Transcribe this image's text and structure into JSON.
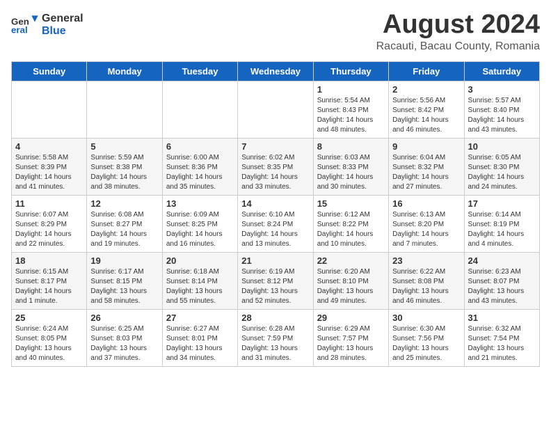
{
  "header": {
    "logo_general": "General",
    "logo_blue": "Blue",
    "month_year": "August 2024",
    "location": "Racauti, Bacau County, Romania"
  },
  "weekdays": [
    "Sunday",
    "Monday",
    "Tuesday",
    "Wednesday",
    "Thursday",
    "Friday",
    "Saturday"
  ],
  "weeks": [
    [
      {
        "day": "",
        "info": ""
      },
      {
        "day": "",
        "info": ""
      },
      {
        "day": "",
        "info": ""
      },
      {
        "day": "",
        "info": ""
      },
      {
        "day": "1",
        "info": "Sunrise: 5:54 AM\nSunset: 8:43 PM\nDaylight: 14 hours\nand 48 minutes."
      },
      {
        "day": "2",
        "info": "Sunrise: 5:56 AM\nSunset: 8:42 PM\nDaylight: 14 hours\nand 46 minutes."
      },
      {
        "day": "3",
        "info": "Sunrise: 5:57 AM\nSunset: 8:40 PM\nDaylight: 14 hours\nand 43 minutes."
      }
    ],
    [
      {
        "day": "4",
        "info": "Sunrise: 5:58 AM\nSunset: 8:39 PM\nDaylight: 14 hours\nand 41 minutes."
      },
      {
        "day": "5",
        "info": "Sunrise: 5:59 AM\nSunset: 8:38 PM\nDaylight: 14 hours\nand 38 minutes."
      },
      {
        "day": "6",
        "info": "Sunrise: 6:00 AM\nSunset: 8:36 PM\nDaylight: 14 hours\nand 35 minutes."
      },
      {
        "day": "7",
        "info": "Sunrise: 6:02 AM\nSunset: 8:35 PM\nDaylight: 14 hours\nand 33 minutes."
      },
      {
        "day": "8",
        "info": "Sunrise: 6:03 AM\nSunset: 8:33 PM\nDaylight: 14 hours\nand 30 minutes."
      },
      {
        "day": "9",
        "info": "Sunrise: 6:04 AM\nSunset: 8:32 PM\nDaylight: 14 hours\nand 27 minutes."
      },
      {
        "day": "10",
        "info": "Sunrise: 6:05 AM\nSunset: 8:30 PM\nDaylight: 14 hours\nand 24 minutes."
      }
    ],
    [
      {
        "day": "11",
        "info": "Sunrise: 6:07 AM\nSunset: 8:29 PM\nDaylight: 14 hours\nand 22 minutes."
      },
      {
        "day": "12",
        "info": "Sunrise: 6:08 AM\nSunset: 8:27 PM\nDaylight: 14 hours\nand 19 minutes."
      },
      {
        "day": "13",
        "info": "Sunrise: 6:09 AM\nSunset: 8:25 PM\nDaylight: 14 hours\nand 16 minutes."
      },
      {
        "day": "14",
        "info": "Sunrise: 6:10 AM\nSunset: 8:24 PM\nDaylight: 14 hours\nand 13 minutes."
      },
      {
        "day": "15",
        "info": "Sunrise: 6:12 AM\nSunset: 8:22 PM\nDaylight: 14 hours\nand 10 minutes."
      },
      {
        "day": "16",
        "info": "Sunrise: 6:13 AM\nSunset: 8:20 PM\nDaylight: 14 hours\nand 7 minutes."
      },
      {
        "day": "17",
        "info": "Sunrise: 6:14 AM\nSunset: 8:19 PM\nDaylight: 14 hours\nand 4 minutes."
      }
    ],
    [
      {
        "day": "18",
        "info": "Sunrise: 6:15 AM\nSunset: 8:17 PM\nDaylight: 14 hours\nand 1 minute."
      },
      {
        "day": "19",
        "info": "Sunrise: 6:17 AM\nSunset: 8:15 PM\nDaylight: 13 hours\nand 58 minutes."
      },
      {
        "day": "20",
        "info": "Sunrise: 6:18 AM\nSunset: 8:14 PM\nDaylight: 13 hours\nand 55 minutes."
      },
      {
        "day": "21",
        "info": "Sunrise: 6:19 AM\nSunset: 8:12 PM\nDaylight: 13 hours\nand 52 minutes."
      },
      {
        "day": "22",
        "info": "Sunrise: 6:20 AM\nSunset: 8:10 PM\nDaylight: 13 hours\nand 49 minutes."
      },
      {
        "day": "23",
        "info": "Sunrise: 6:22 AM\nSunset: 8:08 PM\nDaylight: 13 hours\nand 46 minutes."
      },
      {
        "day": "24",
        "info": "Sunrise: 6:23 AM\nSunset: 8:07 PM\nDaylight: 13 hours\nand 43 minutes."
      }
    ],
    [
      {
        "day": "25",
        "info": "Sunrise: 6:24 AM\nSunset: 8:05 PM\nDaylight: 13 hours\nand 40 minutes."
      },
      {
        "day": "26",
        "info": "Sunrise: 6:25 AM\nSunset: 8:03 PM\nDaylight: 13 hours\nand 37 minutes."
      },
      {
        "day": "27",
        "info": "Sunrise: 6:27 AM\nSunset: 8:01 PM\nDaylight: 13 hours\nand 34 minutes."
      },
      {
        "day": "28",
        "info": "Sunrise: 6:28 AM\nSunset: 7:59 PM\nDaylight: 13 hours\nand 31 minutes."
      },
      {
        "day": "29",
        "info": "Sunrise: 6:29 AM\nSunset: 7:57 PM\nDaylight: 13 hours\nand 28 minutes."
      },
      {
        "day": "30",
        "info": "Sunrise: 6:30 AM\nSunset: 7:56 PM\nDaylight: 13 hours\nand 25 minutes."
      },
      {
        "day": "31",
        "info": "Sunrise: 6:32 AM\nSunset: 7:54 PM\nDaylight: 13 hours\nand 21 minutes."
      }
    ]
  ]
}
